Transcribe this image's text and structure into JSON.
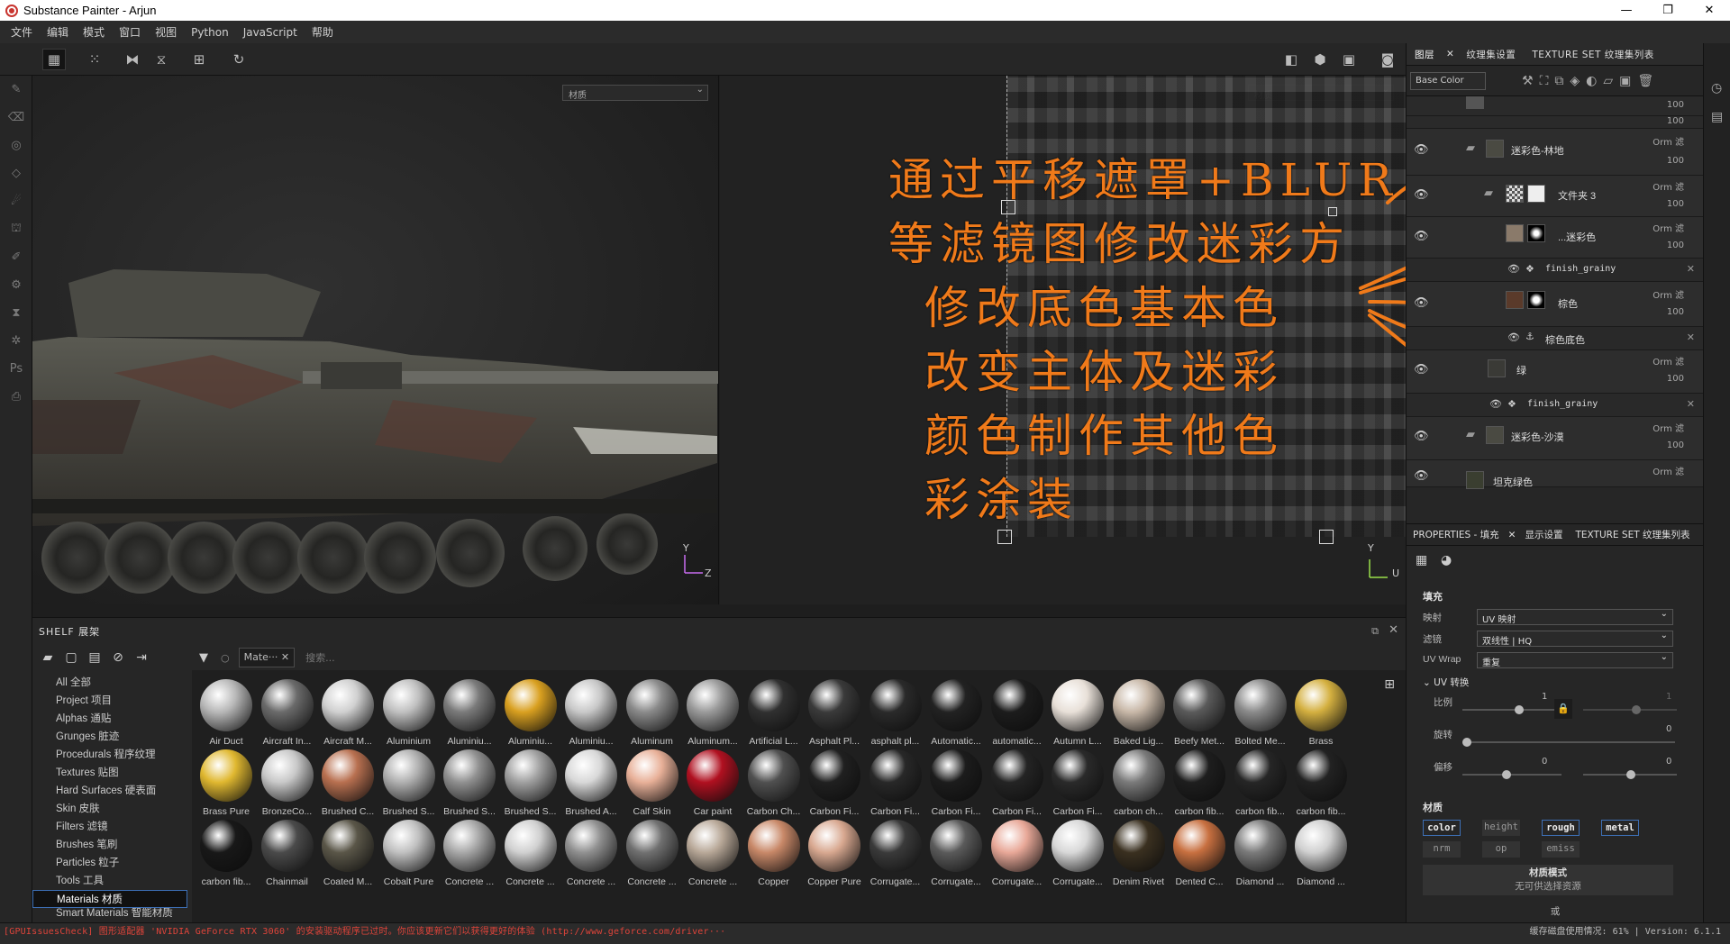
{
  "window": {
    "title": "Substance Painter - Arjun",
    "controls": [
      "—",
      "❐",
      "✕"
    ]
  },
  "menu": [
    "文件",
    "编辑",
    "模式",
    "窗口",
    "视图",
    "Python",
    "JavaScript",
    "帮助"
  ],
  "viewport": {
    "left_select": "材质",
    "right_select": "材质",
    "axis_y": "Y",
    "axis_z": "Z",
    "axis_u": "U",
    "overlay_lines": [
      "通过平移遮罩+BLUR",
      "等滤镜图修改迷彩方",
      "修改底色基本色",
      "改变主体及迷彩",
      "颜色制作其他色",
      "彩涂装"
    ],
    "overlay_color": "#f07a1a"
  },
  "shelf": {
    "title": "SHELF 展架",
    "categories": [
      "All 全部",
      "Project 项目",
      "Alphas 通贴",
      "Grunges 脏迹",
      "Procedurals 程序纹理",
      "Textures 贴图",
      "Hard Surfaces 硬表面",
      "Skin 皮肤",
      "Filters 滤镜",
      "Brushes 笔刷",
      "Particles 粒子",
      "Tools 工具",
      "Materials 材质",
      "Smart Materials 智能材质"
    ],
    "selected_category": "Materials 材质",
    "filter_chip": "Mate···",
    "search_placeholder": "搜索...",
    "materials": [
      {
        "name": "Air Duct",
        "color": "#b8b8b8"
      },
      {
        "name": "Aircraft In...",
        "color": "#6a6a6a"
      },
      {
        "name": "Aircraft M...",
        "color": "#d0d0d0"
      },
      {
        "name": "Aluminium",
        "color": "#c0c0c0"
      },
      {
        "name": "Aluminiu...",
        "color": "#7a7a7a"
      },
      {
        "name": "Aluminiu...",
        "color": "#d9a020"
      },
      {
        "name": "Aluminiu...",
        "color": "#c8c8c8"
      },
      {
        "name": "Aluminum",
        "color": "#8a8a8a"
      },
      {
        "name": "Aluminum...",
        "color": "#9a9a9a"
      },
      {
        "name": "Artificial L...",
        "color": "#303030"
      },
      {
        "name": "Asphalt Pl...",
        "color": "#3a3a3a"
      },
      {
        "name": "asphalt pl...",
        "color": "#2a2a2a"
      },
      {
        "name": "Automatic...",
        "color": "#222222"
      },
      {
        "name": "automatic...",
        "color": "#1c1c1c"
      },
      {
        "name": "Autumn L...",
        "color": "#e8e0d8"
      },
      {
        "name": "Baked Lig...",
        "color": "#c8b8a8"
      },
      {
        "name": "Beefy Met...",
        "color": "#5a5a5a"
      },
      {
        "name": "Bolted Me...",
        "color": "#8a8a8a"
      },
      {
        "name": "Brass",
        "color": "#d4b040"
      },
      {
        "name": "Brass Pure",
        "color": "#e0b830"
      },
      {
        "name": "BronzeCo...",
        "color": "#c8c8c8"
      },
      {
        "name": "Brushed C...",
        "color": "#b87050"
      },
      {
        "name": "Brushed S...",
        "color": "#b0b0b0"
      },
      {
        "name": "Brushed S...",
        "color": "#909090"
      },
      {
        "name": "Brushed S...",
        "color": "#a0a0a0"
      },
      {
        "name": "Brushed A...",
        "color": "#d8d8d8"
      },
      {
        "name": "Calf Skin",
        "color": "#e8b098"
      },
      {
        "name": "Car paint",
        "color": "#b01020"
      },
      {
        "name": "Carbon Ch...",
        "color": "#505050"
      },
      {
        "name": "Carbon Fi...",
        "color": "#202020"
      },
      {
        "name": "Carbon Fi...",
        "color": "#282828"
      },
      {
        "name": "Carbon Fi...",
        "color": "#1c1c1c"
      },
      {
        "name": "Carbon Fi...",
        "color": "#242424"
      },
      {
        "name": "Carbon Fi...",
        "color": "#2a2a2a"
      },
      {
        "name": "carbon ch...",
        "color": "#7a7a7a"
      },
      {
        "name": "carbon fib...",
        "color": "#1e1e1e"
      },
      {
        "name": "carbon fib...",
        "color": "#262626"
      },
      {
        "name": "carbon fib...",
        "color": "#222222"
      },
      {
        "name": "carbon fib...",
        "color": "#181818"
      },
      {
        "name": "Chainmail",
        "color": "#4a4a4a"
      },
      {
        "name": "Coated M...",
        "color": "#5a5648"
      },
      {
        "name": "Cobalt Pure",
        "color": "#c0c0c0"
      },
      {
        "name": "Concrete ...",
        "color": "#a8a8a8"
      },
      {
        "name": "Concrete ...",
        "color": "#d0d0d0"
      },
      {
        "name": "Concrete ...",
        "color": "#909090"
      },
      {
        "name": "Concrete ...",
        "color": "#707070"
      },
      {
        "name": "Concrete ...",
        "color": "#b8a898"
      },
      {
        "name": "Copper",
        "color": "#c88868"
      },
      {
        "name": "Copper Pure",
        "color": "#d8a890"
      },
      {
        "name": "Corrugate...",
        "color": "#3a3a3a"
      },
      {
        "name": "Corrugate...",
        "color": "#5a5a5a"
      },
      {
        "name": "Corrugate...",
        "color": "#e8a898"
      },
      {
        "name": "Corrugate...",
        "color": "#d8d8d8"
      },
      {
        "name": "Denim Rivet",
        "color": "#3a3020"
      },
      {
        "name": "Dented C...",
        "color": "#c87040"
      },
      {
        "name": "Diamond ...",
        "color": "#7a7a7a"
      },
      {
        "name": "Diamond ...",
        "color": "#d0d0d0"
      }
    ]
  },
  "layers_panel": {
    "tabs": [
      "图层",
      "纹理集设置",
      "TEXTURE SET 纹理集列表"
    ],
    "channel_select": "Base Color",
    "layers": [
      {
        "name": "迷彩色-林地",
        "mode": "Orm 滤",
        "opacity": "100",
        "type": "folder"
      },
      {
        "name": "文件夹 3",
        "mode": "Orm 滤",
        "opacity": "100",
        "type": "folder-child"
      },
      {
        "name": "...迷彩色",
        "mode": "Orm 滤",
        "opacity": "100",
        "type": "fill"
      },
      {
        "name": "finish_grainy",
        "type": "effect"
      },
      {
        "name": "棕色",
        "mode": "Orm 滤",
        "opacity": "100",
        "type": "fill"
      },
      {
        "name": "棕色底色",
        "type": "anchor"
      },
      {
        "name": "绿",
        "mode": "Orm 滤",
        "opacity": "100",
        "type": "fill"
      },
      {
        "name": "finish_grainy",
        "type": "effect"
      },
      {
        "name": "迷彩色-沙漠",
        "mode": "Orm 滤",
        "opacity": "100",
        "type": "folder"
      },
      {
        "name": "坦克绿色",
        "mode": "Orm 滤",
        "opacity": "",
        "type": "fill"
      }
    ]
  },
  "properties": {
    "tabs": [
      "PROPERTIES - 填充",
      "显示设置",
      "TEXTURE SET 纹理集列表"
    ],
    "section_fill": "填充",
    "mapping_label": "映射",
    "mapping_value": "UV 映射",
    "filter_label": "滤镜",
    "filter_value": "双线性 | HQ",
    "uvwrap_label": "UV Wrap",
    "uvwrap_value": "重复",
    "uv_transform": "UV 转换",
    "scale_label": "比例",
    "scale_value": "1",
    "scale_value2": "1",
    "rotate_label": "旋转",
    "rotate_value": "0",
    "offset_label": "偏移",
    "offset_value1": "0",
    "offset_value2": "0",
    "material_section": "材质",
    "channels_row1": [
      "color",
      "height",
      "rough",
      "metal"
    ],
    "channels_row2": [
      "nrm",
      "op",
      "emiss"
    ],
    "material_mode_title": "材质模式",
    "material_mode_sub": "无可供选择资源",
    "or_label": "或"
  },
  "status": {
    "left": "[GPUIssuesCheck] 图形适配器 'NVIDIA GeForce RTX 3060' 的安装驱动程序已过时。你应该更新它们以获得更好的体验 (http://www.geforce.com/driver···",
    "right": "缓存磁盘使用情况: 61% | Version: 6.1.1"
  }
}
